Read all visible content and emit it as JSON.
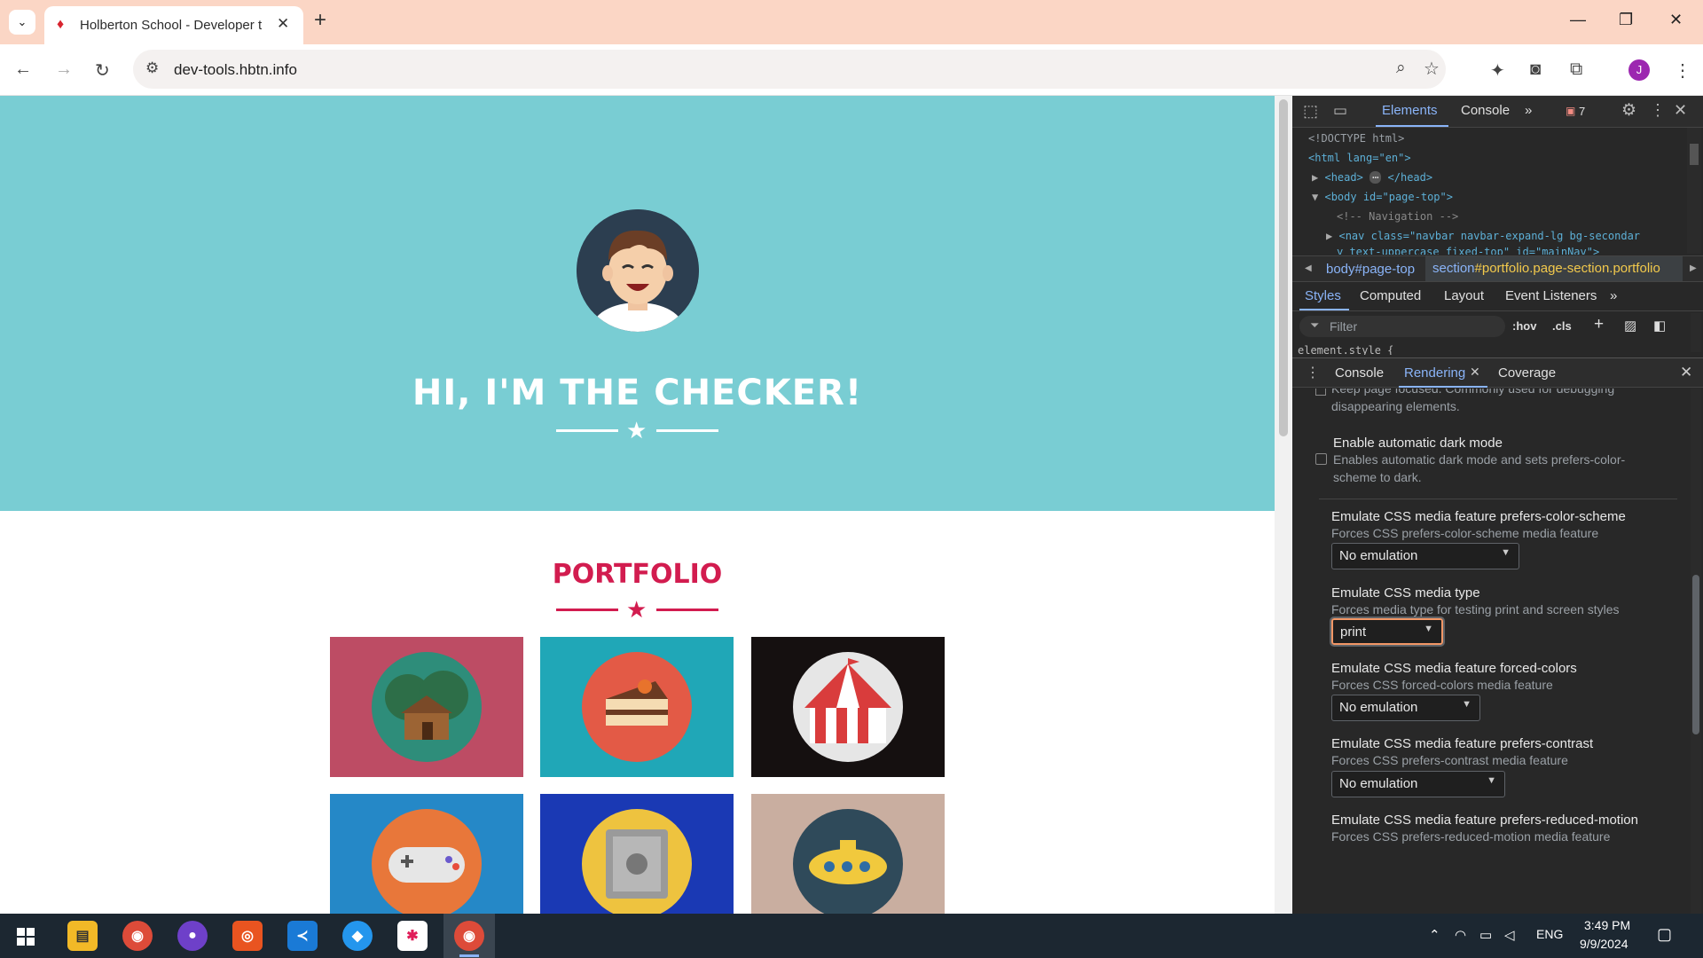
{
  "browser": {
    "tab_title": "Holberton School - Developer t",
    "url": "dev-tools.hbtn.info",
    "profile_initial": "J"
  },
  "page": {
    "hero_title": "HI, I'M THE CHECKER!",
    "portfolio_title": "PORTFOLIO"
  },
  "devtools": {
    "tabs": [
      "Elements",
      "Console"
    ],
    "issues_count": "7",
    "code_lines": {
      "doctype": "<!DOCTYPE html>",
      "html_open": "<html lang=\"en\">",
      "head": "<head>",
      "head_close": "</head>",
      "body_tag": "<body id=\"page-top\">",
      "comment": "<!-- Navigation -->",
      "nav_line1": "<nav class=\"navbar navbar-expand-lg bg-secondar",
      "nav_line2": "y text-uppercase fixed-top\" id=\"mainNav\">"
    },
    "breadcrumb": {
      "body": "body#page-top",
      "section_prefix": "section",
      "section_rest": "#portfolio.page-section.portfolio"
    },
    "style_tabs": [
      "Styles",
      "Computed",
      "Layout",
      "Event Listeners"
    ],
    "filter_placeholder": "Filter",
    "hov": ":hov",
    "cls": ".cls",
    "element_style": "element.style {",
    "drawer_tabs": [
      "Console",
      "Rendering",
      "Coverage"
    ],
    "rendering": {
      "truncated_text": "Keep page focused. Commonly used for debugging disappearing elements.",
      "dark_mode_title": "Enable automatic dark mode",
      "dark_mode_desc": "Enables automatic dark mode and sets prefers-color-scheme to dark.",
      "sections": [
        {
          "title": "Emulate CSS media feature prefers-color-scheme",
          "desc": "Forces CSS prefers-color-scheme media feature",
          "value": "No emulation"
        },
        {
          "title": "Emulate CSS media type",
          "desc": "Forces media type for testing print and screen styles",
          "value": "print"
        },
        {
          "title": "Emulate CSS media feature forced-colors",
          "desc": "Forces CSS forced-colors media feature",
          "value": "No emulation"
        },
        {
          "title": "Emulate CSS media feature prefers-contrast",
          "desc": "Forces CSS prefers-contrast media feature",
          "value": "No emulation"
        },
        {
          "title": "Emulate CSS media feature prefers-reduced-motion",
          "desc": "Forces CSS prefers-reduced-motion media feature",
          "value": ""
        }
      ]
    }
  },
  "taskbar": {
    "language": "ENG",
    "time": "3:49 PM",
    "date": "9/9/2024"
  },
  "colors": {
    "hero_bg": "#79cdd3",
    "accent": "#d21c4f",
    "devtools_bg": "#282828",
    "tab_bar": "#fbd6c5"
  }
}
